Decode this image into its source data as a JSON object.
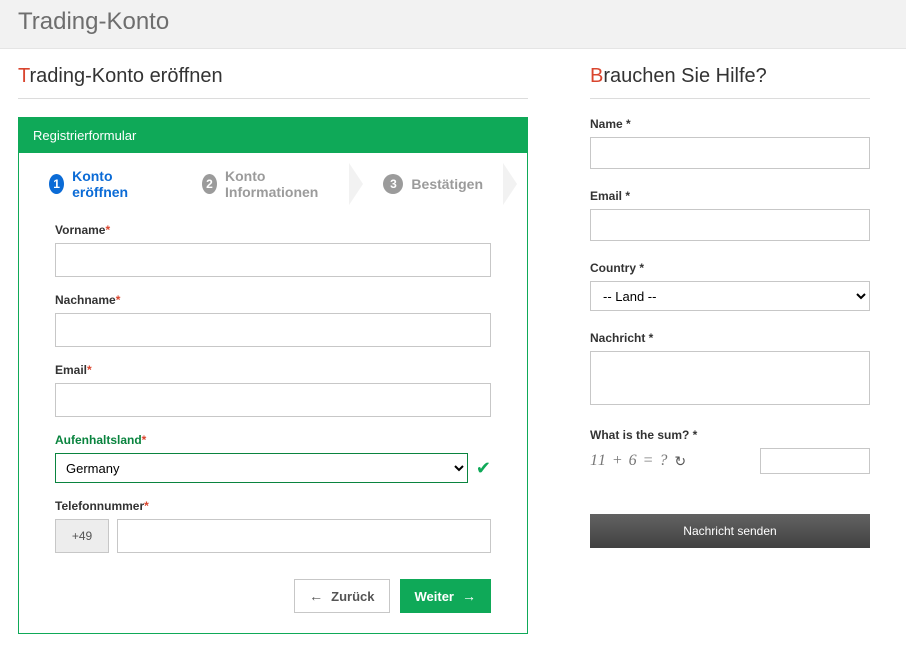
{
  "header": {
    "title": "Trading-Konto"
  },
  "main": {
    "title_first": "T",
    "title_rest": "rading-Konto eröffnen",
    "panel_header": "Registrierformular",
    "steps": [
      {
        "num": "1",
        "label": "Konto eröffnen"
      },
      {
        "num": "2",
        "label": "Konto Informationen"
      },
      {
        "num": "3",
        "label": "Bestätigen"
      }
    ],
    "fields": {
      "firstname_label": "Vorname",
      "lastname_label": "Nachname",
      "email_label": "Email",
      "country_label": "Aufenhaltsland",
      "country_value": "Germany",
      "phone_label": "Telefonnummer",
      "dial_code": "+49"
    },
    "buttons": {
      "back": "Zurück",
      "next": "Weiter"
    }
  },
  "help": {
    "title_first": "B",
    "title_rest": "rauchen Sie Hilfe?",
    "name_label": "Name *",
    "email_label": "Email *",
    "country_label": "Country *",
    "country_placeholder": "-- Land --",
    "message_label": "Nachricht *",
    "captcha_label": "What is the sum? *",
    "captcha_text": "11 + 6 = ?",
    "send": "Nachricht senden"
  }
}
